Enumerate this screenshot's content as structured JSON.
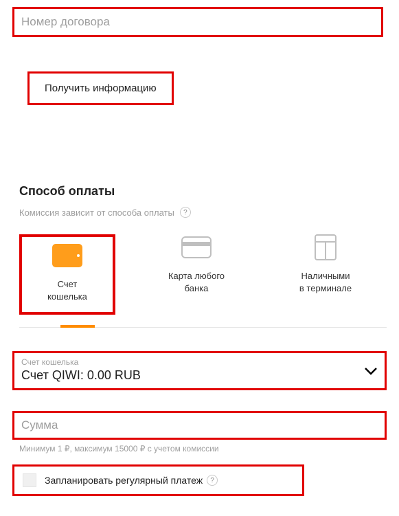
{
  "contract": {
    "placeholder": "Номер договора"
  },
  "get_info_label": "Получить информацию",
  "payment_method": {
    "title": "Способ оплаты",
    "commission_text": "Комиссия зависит от способа оплаты",
    "methods": {
      "wallet": "Счет\nкошелька",
      "card": "Карта любого\nбанка",
      "cash": "Наличными\nв терминале"
    }
  },
  "wallet_select": {
    "label": "Счет кошелька",
    "value": "Счет QIWI: 0.00 RUB"
  },
  "sum": {
    "placeholder": "Сумма",
    "hint": "Минимум 1 ₽, максимум 15000 ₽ с учетом комиссии"
  },
  "schedule": {
    "label": "Запланировать регулярный платеж"
  }
}
